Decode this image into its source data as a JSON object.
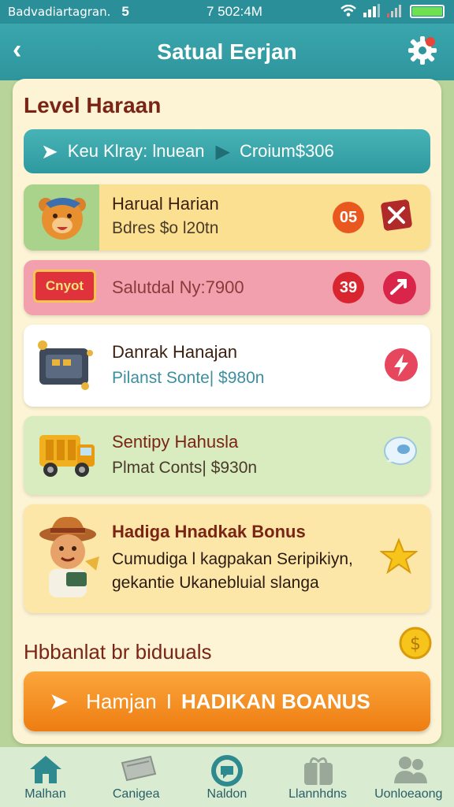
{
  "status": {
    "carrier": "Badvadiartagran.",
    "signal": "5",
    "time": "7 502:4M"
  },
  "header": {
    "title": "Satual Eerjan"
  },
  "section_title": "Level Haraan",
  "filter": {
    "label_left": "Keu Klray: lnuean",
    "label_right": "Croium$306"
  },
  "cards": [
    {
      "name": "Harual Harian",
      "sub": "Bdres $o l20tn",
      "badge": "05"
    },
    {
      "name": "Salutdal Ny:7900",
      "tag": "Cnyot",
      "badge": "39"
    },
    {
      "name": "Danrak Hanajan",
      "sub": "Pilanst Sonte| $980n"
    },
    {
      "name": "Sentipy Hahusla",
      "sub": "Plmat Conts| $930n"
    },
    {
      "name": "Hadiga Hnadkak Bonus",
      "sub1": "Cumudiga l kagpakan Seripikiyn,",
      "sub2": "gekantie Ukanebluial slanga"
    }
  ],
  "footer_label": "Hbbanlat br biduuals",
  "cta": {
    "left": "Hamjan",
    "sep": "I",
    "right": "HADIKAN BOANUS"
  },
  "nav": [
    {
      "label": "Malhan",
      "icon": "home-icon"
    },
    {
      "label": "Canigea",
      "icon": "ticket-icon"
    },
    {
      "label": "Naldon",
      "icon": "chat-icon"
    },
    {
      "label": "Llannhdns",
      "icon": "gift-icon"
    },
    {
      "label": "Uonloeaong",
      "icon": "people-icon"
    }
  ],
  "colors": {
    "teal": "#2f959d",
    "orange": "#ee7d12",
    "maroon": "#7a2415"
  }
}
